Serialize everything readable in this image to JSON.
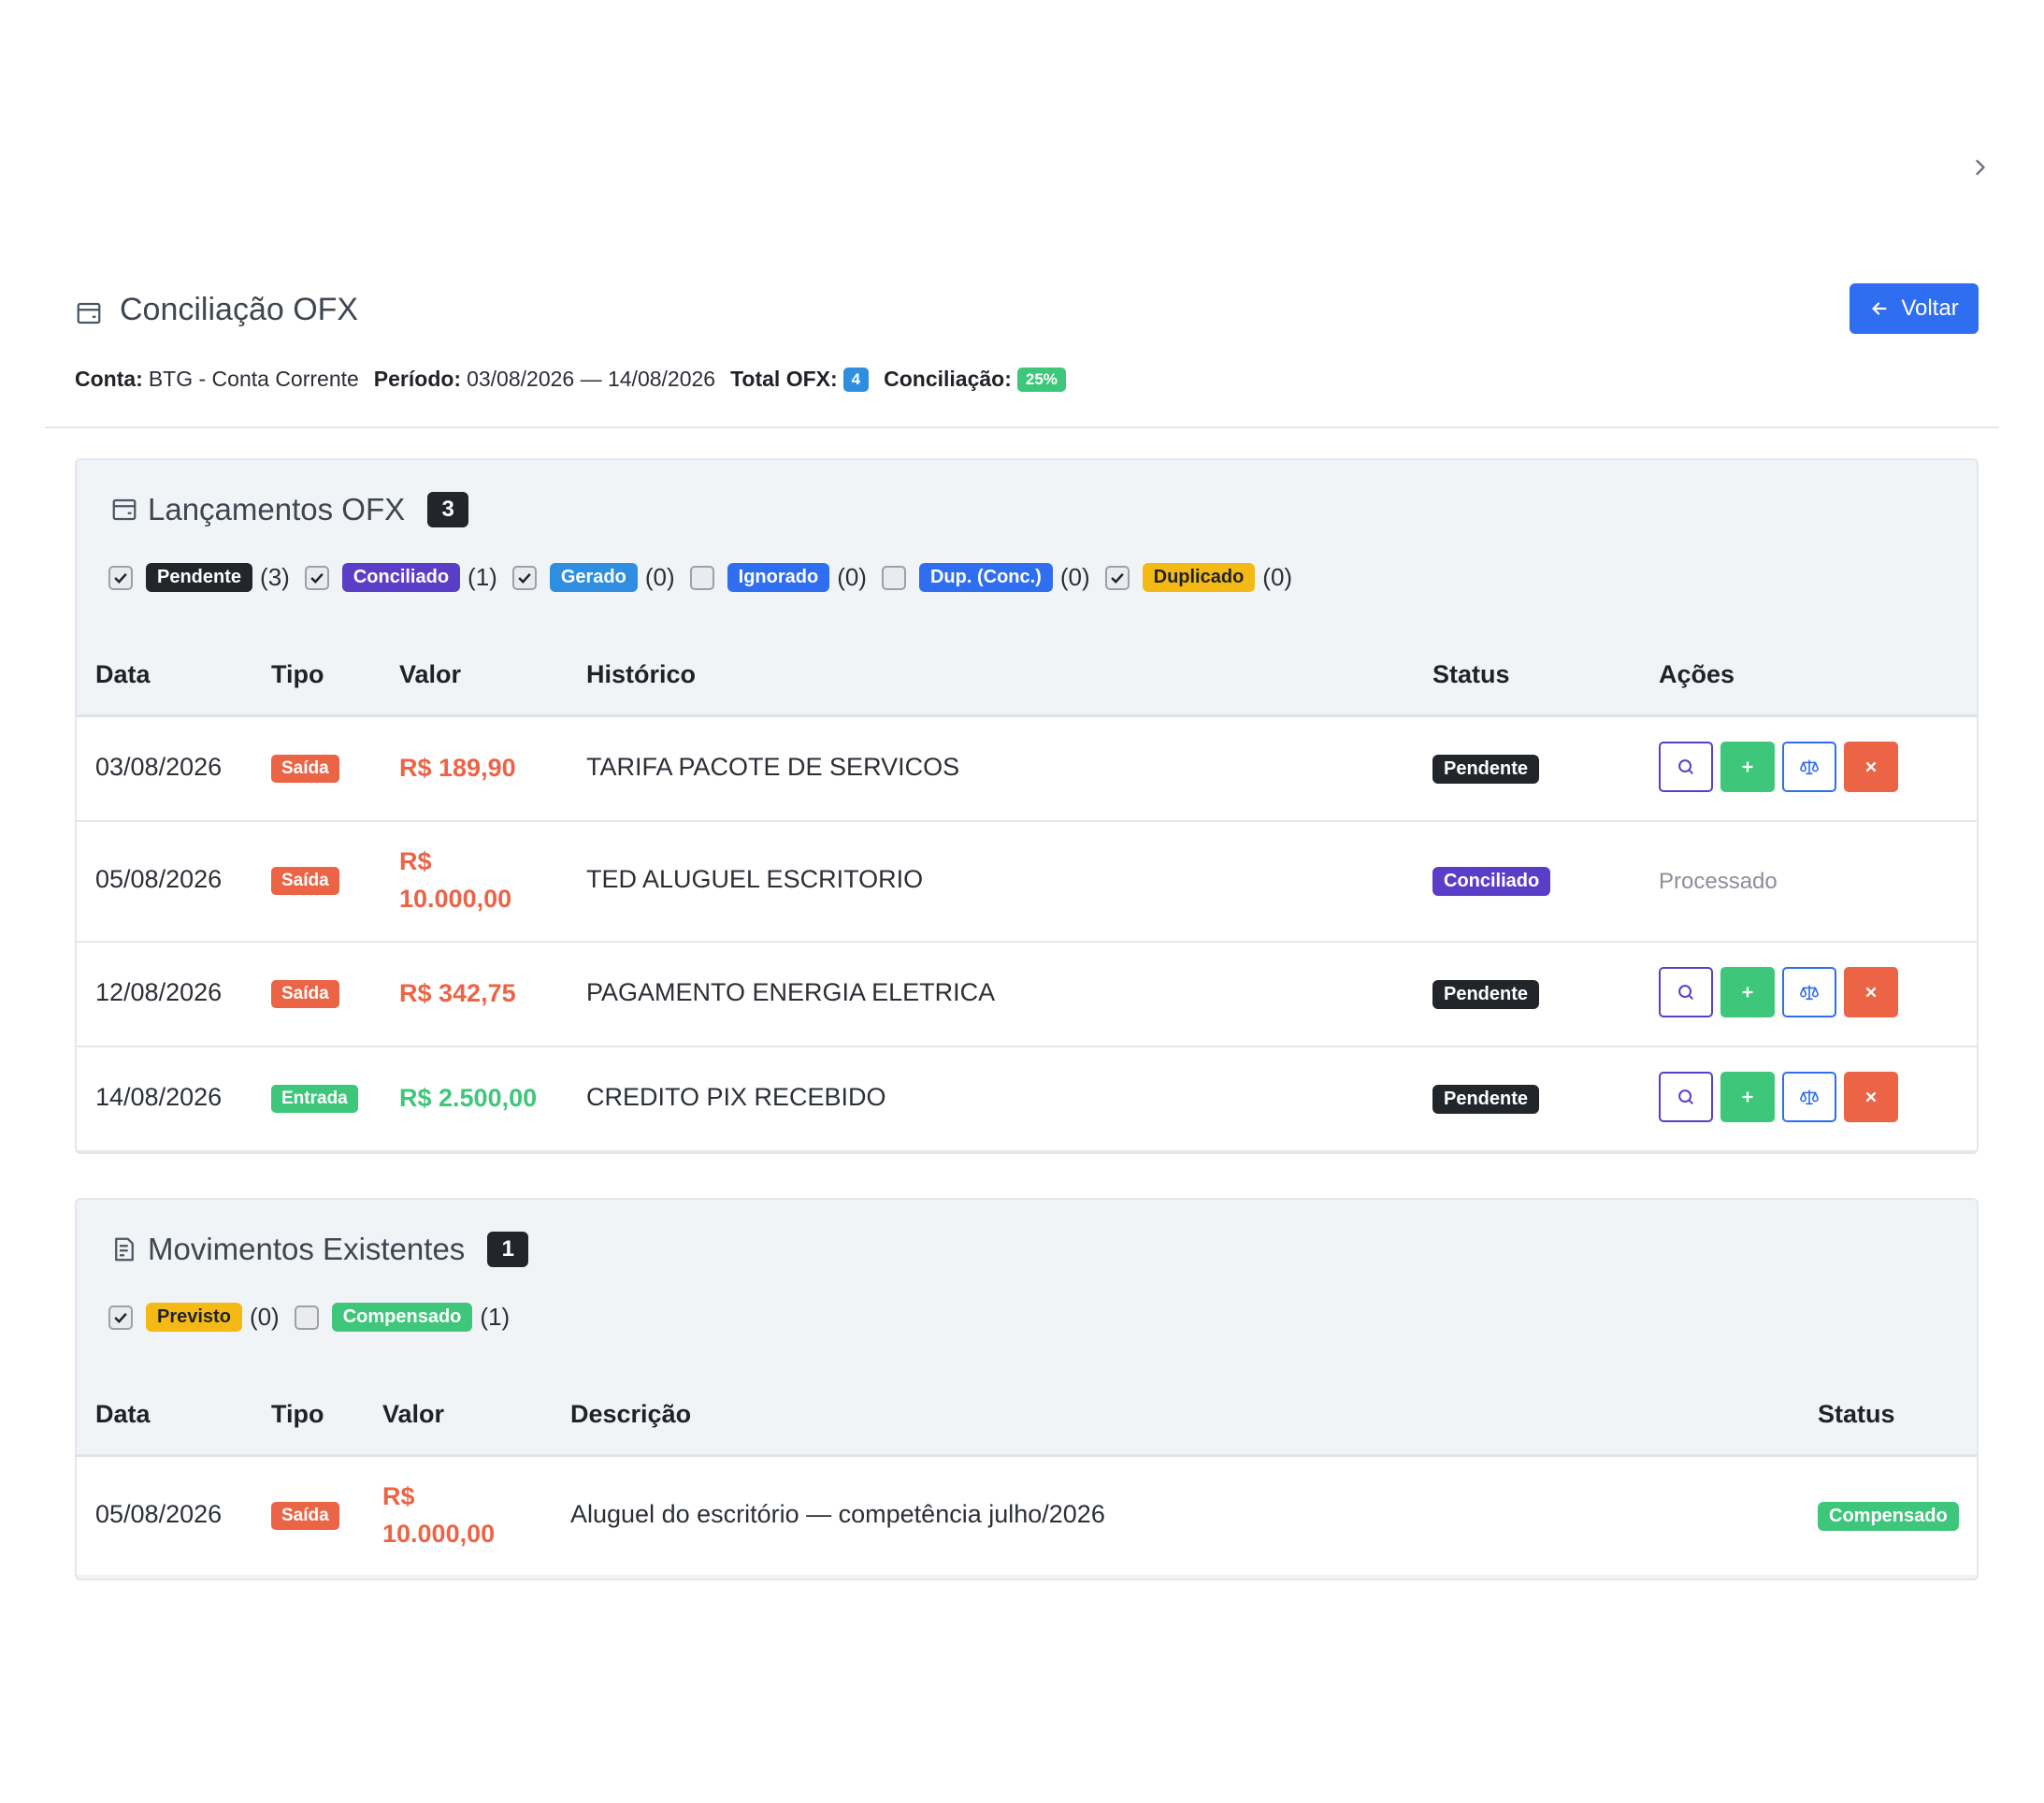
{
  "header": {
    "title": "Conciliação OFX",
    "back_label": "Voltar",
    "conta_label": "Conta:",
    "conta_value": "BTG - Conta Corrente",
    "periodo_label": "Período:",
    "periodo_value": "03/08/2026 — 14/08/2026",
    "total_label": "Total OFX:",
    "total_value": "4",
    "conc_label": "Conciliação:",
    "conc_value": "25%"
  },
  "colors": {
    "primary": "#2f6ef0",
    "pendente": "#22262b",
    "conciliado": "#5b3ec8",
    "gerado": "#2f8ee0",
    "ignorado": "#2f6ef0",
    "duplicado": "#f5b916",
    "saida": "#ec6446",
    "entrada": "#3ec77a"
  },
  "ofx": {
    "title": "Lançamentos OFX",
    "count": "3",
    "filters": [
      {
        "label": "Pendente",
        "count": "(3)",
        "checked": true
      },
      {
        "label": "Conciliado",
        "count": "(1)",
        "checked": true
      },
      {
        "label": "Gerado",
        "count": "(0)",
        "checked": true
      },
      {
        "label": "Ignorado",
        "count": "(0)",
        "checked": false
      },
      {
        "label": "Dup. (Conc.)",
        "count": "(0)",
        "checked": false
      },
      {
        "label": "Duplicado",
        "count": "(0)",
        "checked": true
      }
    ],
    "columns": [
      "Data",
      "Tipo",
      "Valor",
      "Histórico",
      "Status",
      "Ações"
    ],
    "rows": [
      {
        "data": "03/08/2026",
        "tipo": "Saída",
        "valor": "R$ 189,90",
        "historico": "TARIFA PACOTE DE SERVICOS",
        "status": "Pendente"
      },
      {
        "data": "05/08/2026",
        "tipo": "Saída",
        "valor_l1": "R$",
        "valor_l2": "10.000,00",
        "historico": "TED ALUGUEL ESCRITORIO",
        "status": "Conciliado",
        "acoes": "Processado"
      },
      {
        "data": "12/08/2026",
        "tipo": "Saída",
        "valor": "R$ 342,75",
        "historico": "PAGAMENTO ENERGIA ELETRICA",
        "status": "Pendente"
      },
      {
        "data": "14/08/2026",
        "tipo": "Entrada",
        "valor": "R$ 2.500,00",
        "historico": "CREDITO PIX RECEBIDO",
        "status": "Pendente"
      }
    ]
  },
  "mov": {
    "title": "Movimentos Existentes",
    "count": "1",
    "filters": [
      {
        "label": "Previsto",
        "count": "(0)",
        "checked": true
      },
      {
        "label": "Compensado",
        "count": "(1)",
        "checked": false
      }
    ],
    "columns": [
      "Data",
      "Tipo",
      "Valor",
      "Descrição",
      "Status"
    ],
    "rows": [
      {
        "data": "05/08/2026",
        "tipo": "Saída",
        "valor_l1": "R$",
        "valor_l2": "10.000,00",
        "descricao": "Aluguel do escritório — competência julho/2026",
        "status": "Compensado"
      }
    ]
  }
}
